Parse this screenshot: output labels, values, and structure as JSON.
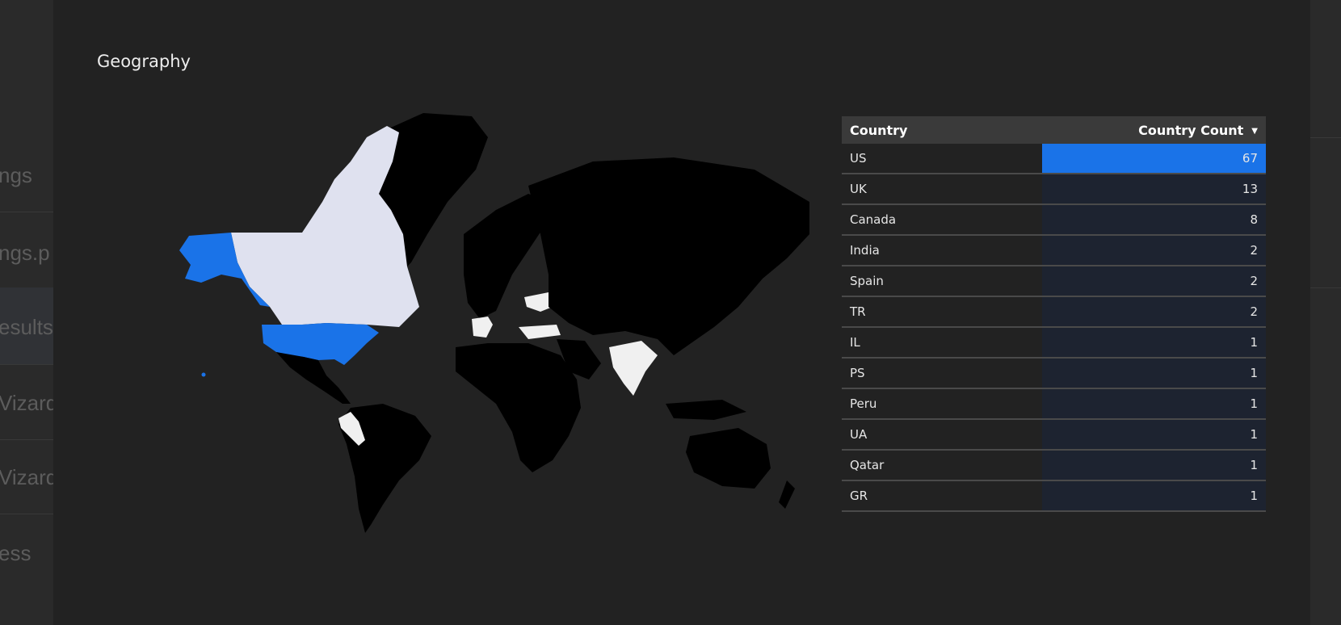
{
  "background": {
    "items": [
      "ngs",
      "ngs.p",
      "esults",
      "Vizard",
      "Vizard",
      "ess"
    ]
  },
  "panel": {
    "title": "Geography"
  },
  "map": {
    "highlight_color": "#1a73e8",
    "secondary_color": "#dfe1ef",
    "light_color": "#f0f0f0",
    "land_color": "#000000"
  },
  "table": {
    "headers": [
      "Country",
      "Country Count"
    ],
    "sort": "descending",
    "bar_color": "#1a73e8",
    "max_value": 67,
    "rows": [
      {
        "country": "US",
        "count": 67
      },
      {
        "country": "UK",
        "count": 13
      },
      {
        "country": "Canada",
        "count": 8
      },
      {
        "country": "India",
        "count": 2
      },
      {
        "country": "Spain",
        "count": 2
      },
      {
        "country": "TR",
        "count": 2
      },
      {
        "country": "IL",
        "count": 1
      },
      {
        "country": "PS",
        "count": 1
      },
      {
        "country": "Peru",
        "count": 1
      },
      {
        "country": "UA",
        "count": 1
      },
      {
        "country": "Qatar",
        "count": 1
      },
      {
        "country": "GR",
        "count": 1
      }
    ]
  }
}
